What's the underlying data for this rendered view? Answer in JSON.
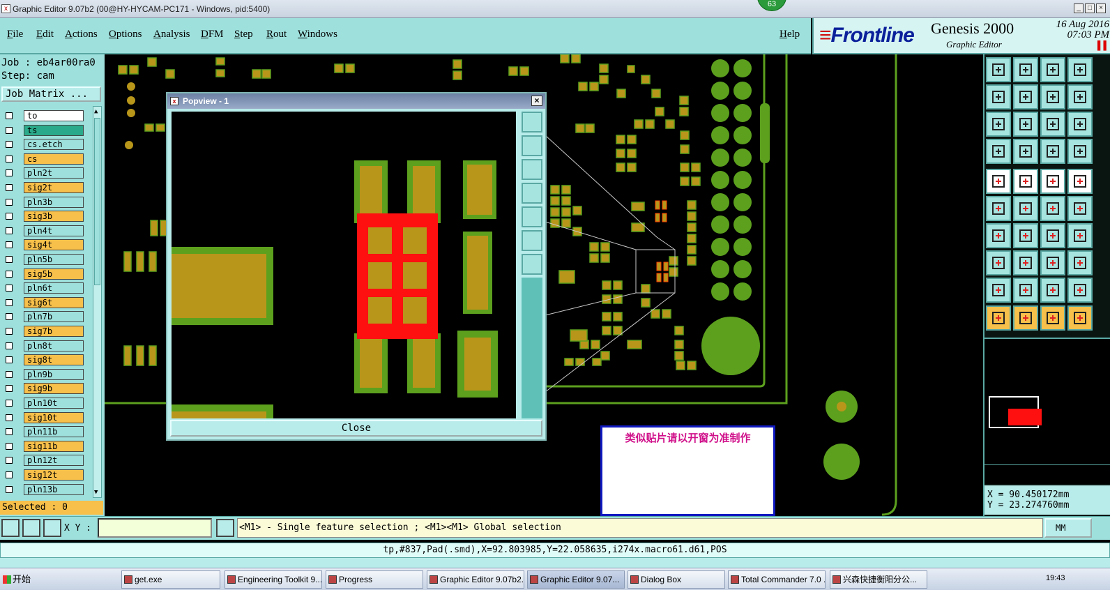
{
  "window": {
    "title": "Graphic Editor 9.07b2 (00@HY-HYCAM-PC171 - Windows, pid:5400)",
    "badge": "63"
  },
  "menu": {
    "items": [
      "File",
      "Edit",
      "Actions",
      "Options",
      "Analysis",
      "DFM",
      "Step",
      "Rout",
      "Windows"
    ],
    "help": "Help"
  },
  "brand": {
    "logo": "Frontline",
    "product": "Genesis 2000",
    "subtitle": "Graphic Editor",
    "date": "16 Aug 2016",
    "time": "07:03 PM"
  },
  "job": {
    "job_label": "Job : eb4ar00ra0",
    "step_label": "Step: cam",
    "matrix_button": "Job Matrix ..."
  },
  "layers": [
    {
      "name": "to",
      "color": "#ffffff"
    },
    {
      "name": "ts",
      "color": "#2aaa8a"
    },
    {
      "name": "cs.etch",
      "color": "#9ee0dc"
    },
    {
      "name": "cs",
      "color": "#f7c04a"
    },
    {
      "name": "pln2t",
      "color": "#9ee0dc"
    },
    {
      "name": "sig2t",
      "color": "#f7c04a"
    },
    {
      "name": "pln3b",
      "color": "#9ee0dc"
    },
    {
      "name": "sig3b",
      "color": "#f7c04a"
    },
    {
      "name": "pln4t",
      "color": "#9ee0dc"
    },
    {
      "name": "sig4t",
      "color": "#f7c04a"
    },
    {
      "name": "pln5b",
      "color": "#9ee0dc"
    },
    {
      "name": "sig5b",
      "color": "#f7c04a"
    },
    {
      "name": "pln6t",
      "color": "#9ee0dc"
    },
    {
      "name": "sig6t",
      "color": "#f7c04a"
    },
    {
      "name": "pln7b",
      "color": "#9ee0dc"
    },
    {
      "name": "sig7b",
      "color": "#f7c04a"
    },
    {
      "name": "pln8t",
      "color": "#9ee0dc"
    },
    {
      "name": "sig8t",
      "color": "#f7c04a"
    },
    {
      "name": "pln9b",
      "color": "#9ee0dc"
    },
    {
      "name": "sig9b",
      "color": "#f7c04a"
    },
    {
      "name": "pln10t",
      "color": "#9ee0dc"
    },
    {
      "name": "sig10t",
      "color": "#f7c04a"
    },
    {
      "name": "pln11b",
      "color": "#9ee0dc"
    },
    {
      "name": "sig11b",
      "color": "#f7c04a"
    },
    {
      "name": "pln12t",
      "color": "#9ee0dc"
    },
    {
      "name": "sig12t",
      "color": "#f7c04a"
    },
    {
      "name": "pln13b",
      "color": "#9ee0dc"
    }
  ],
  "selected": "Selected : 0",
  "popview": {
    "title": "Popview - 1",
    "close_label": "Close"
  },
  "note": "类似贴片请以开窗为准制作",
  "coords": {
    "x": "X = 90.450172mm",
    "y": "Y = 23.274760mm"
  },
  "bottom": {
    "xy_label": "X Y :",
    "hint": "<M1> - Single feature selection ; <M1><M1> Global selection",
    "unit": "MM",
    "info": "tp,#837,Pad(.smd),X=92.803985,Y=22.058635,i274x.macro61.d61,POS"
  },
  "taskbar": {
    "start": "开始",
    "tasks": [
      "get.exe",
      "Engineering Toolkit 9....",
      "Progress",
      "Graphic Editor 9.07b2...",
      "Graphic Editor 9.07...",
      "Dialog Box",
      "Total Commander 7.0 ...",
      "兴森快捷衡阳分公..."
    ],
    "clock": "19:43"
  },
  "colors": {
    "panel": "#9ee0dc",
    "copper": "#b8961a",
    "mask": "#5ca01e",
    "highlight": "#ff1010"
  }
}
